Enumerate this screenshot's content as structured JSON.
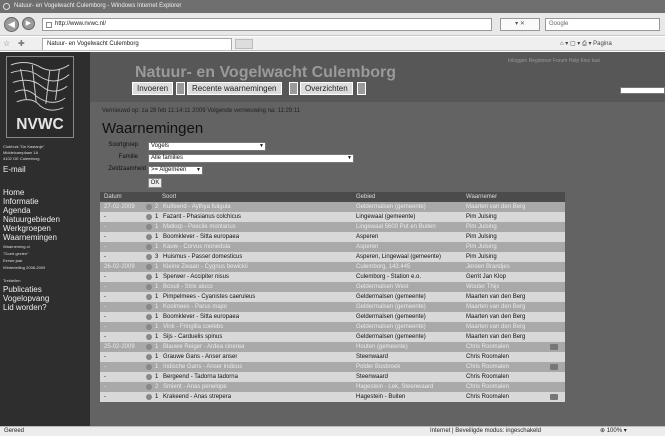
{
  "window": {
    "title": "Natuur- en Vogelwacht Culemborg - Windows Internet Explorer"
  },
  "address": {
    "url": "http://www.nvwc.nl/",
    "controls": "▾ ✕",
    "search_placeholder": "Google"
  },
  "tab": {
    "label": "Natuur- en Vogelwacht Culemborg",
    "cmd": "⌂ ▾ ▢ ▾ ⎙ ▾ Pagina"
  },
  "sidebar": {
    "address_lines": [
      "Clubhuis \"De Kastanje\"",
      "Middelcamplaan 1A",
      "4102 GE Culemborg"
    ],
    "email": "E-mail",
    "links": [
      "Home",
      "Informatie",
      "Agenda",
      "Natuurgebieden",
      "Werkgroepen",
      "Waarnemingen"
    ],
    "sublinks": [
      "Waarneming.nl",
      "\"Goed gezien\"",
      "Eerste jaar",
      "Wintertelling 2008-2009",
      "Trektellen"
    ],
    "links2": [
      "Publicaties",
      "Vogelopvang",
      "Lid worden?"
    ]
  },
  "header": {
    "site_title": "Natuur- en Vogelwacht Culemborg",
    "top_links": "Inloggen  Registreer  Forum  Help  Kies taal",
    "nav": [
      "Invoeren",
      "Recente waarnemingen",
      "Overzichten"
    ]
  },
  "main": {
    "update_text": "Vernieuwd op: za 28 feb 11:14:11 2009  Volgende vernieuwing na: 11:29:11",
    "title": "Waarnemingen",
    "filters": [
      {
        "label": "Soortgroep",
        "value": "Vogels"
      },
      {
        "label": "Familie",
        "value": "Alle families"
      },
      {
        "label": "Zeldzaamheid",
        "value": ">= Algemeen"
      }
    ],
    "ok": "OK"
  },
  "table": {
    "headers": [
      "Datum",
      "Soort",
      "Gebied",
      "Waarnemer"
    ],
    "rows": [
      {
        "date": "27-02-2009",
        "n": "2",
        "species": "Kuifeend - Aythya fuligula",
        "area": "Geldermalsen (gemeente)",
        "observer": "Maarten van den Berg",
        "shade": "mid"
      },
      {
        "date": "-",
        "n": "1",
        "species": "Fazant - Phasianus colchicus",
        "area": "Lingewaal (gemeente)",
        "observer": "Pim Julsing",
        "shade": "light"
      },
      {
        "date": "-",
        "n": "1",
        "species": "Matkop - Poecile montanus",
        "area": "Lingewaal 5600 Put en Buiten",
        "observer": "Pim Julsing",
        "shade": "mid"
      },
      {
        "date": "-",
        "n": "1",
        "species": "Boomklever - Sitta europaea",
        "area": "Asperen",
        "observer": "Pim Julsing",
        "shade": "light"
      },
      {
        "date": "-",
        "n": "1",
        "species": "Kauw - Corvus monedula",
        "area": "Asperen",
        "observer": "Pim Julsing",
        "shade": "mid"
      },
      {
        "date": "-",
        "n": "3",
        "species": "Huismus - Passer domesticus",
        "area": "Asperen, Lingewaal (gemeente)",
        "observer": "Pim Julsing",
        "shade": "light"
      },
      {
        "date": "26-02-2009",
        "n": "1",
        "species": "Kleine Zwaan - Cygnus bewickii",
        "area": "Culemborg, 143.445",
        "observer": "Jeroen Brandjes",
        "shade": "mid"
      },
      {
        "date": "-",
        "n": "1",
        "species": "Sperwer - Accipiter nisus",
        "area": "Culemborg - Station e.o.",
        "observer": "Gerrit Jan Klop",
        "shade": "light"
      },
      {
        "date": "-",
        "n": "1",
        "species": "Bosuil - Strix aluco",
        "area": "Geldermalsen West",
        "observer": "Wouter Thijs",
        "shade": "mid"
      },
      {
        "date": "-",
        "n": "1",
        "species": "Pimpelmees - Cyanistes caeruleus",
        "area": "Geldermalsen (gemeente)",
        "observer": "Maarten van den Berg",
        "shade": "light"
      },
      {
        "date": "-",
        "n": "1",
        "species": "Koolmees - Parus major",
        "area": "Geldermalsen (gemeente)",
        "observer": "Maarten van den Berg",
        "shade": "mid"
      },
      {
        "date": "-",
        "n": "1",
        "species": "Boomklever - Sitta europaea",
        "area": "Geldermalsen (gemeente)",
        "observer": "Maarten van den Berg",
        "shade": "light"
      },
      {
        "date": "-",
        "n": "1",
        "species": "Vink - Fringilla coelebs",
        "area": "Geldermalsen (gemeente)",
        "observer": "Maarten van den Berg",
        "shade": "mid"
      },
      {
        "date": "-",
        "n": "1",
        "species": "Sijs - Carduelis spinus",
        "area": "Geldermalsen (gemeente)",
        "observer": "Maarten van den Berg",
        "shade": "light"
      },
      {
        "date": "25-02-2009",
        "n": "1",
        "species": "Blauwe Reiger - Ardea cinerea",
        "area": "Houten (gemeente)",
        "observer": "Chris Roomalen",
        "shade": "mid",
        "cam": true
      },
      {
        "date": "-",
        "n": "1",
        "species": "Grauwe Gans - Anser anser",
        "area": "Steenwaard",
        "observer": "Chris Roomalen",
        "shade": "light"
      },
      {
        "date": "-",
        "n": "1",
        "species": "Indische Gans - Anser indicus",
        "area": "Polder Bosbroek",
        "observer": "Chris Roomalen",
        "shade": "mid",
        "cam": true
      },
      {
        "date": "-",
        "n": "1",
        "species": "Bergeend - Tadorna tadorna",
        "area": "Steenwaard",
        "observer": "Chris Roomalen",
        "shade": "light"
      },
      {
        "date": "-",
        "n": "2",
        "species": "Smient - Anas penelope",
        "area": "Hagestein - Lek, Steenwaard",
        "observer": "Chris Roomalen",
        "shade": "mid"
      },
      {
        "date": "-",
        "n": "1",
        "species": "Krakeend - Anas strepera",
        "area": "Hagestein - Buiten",
        "observer": "Chris Roomalen",
        "shade": "light",
        "cam": true
      }
    ]
  },
  "status": {
    "left": "Gereed",
    "right": "Internet | Beveiligde modus: ingeschakeld",
    "zoom": "⊕ 100% ▾"
  }
}
